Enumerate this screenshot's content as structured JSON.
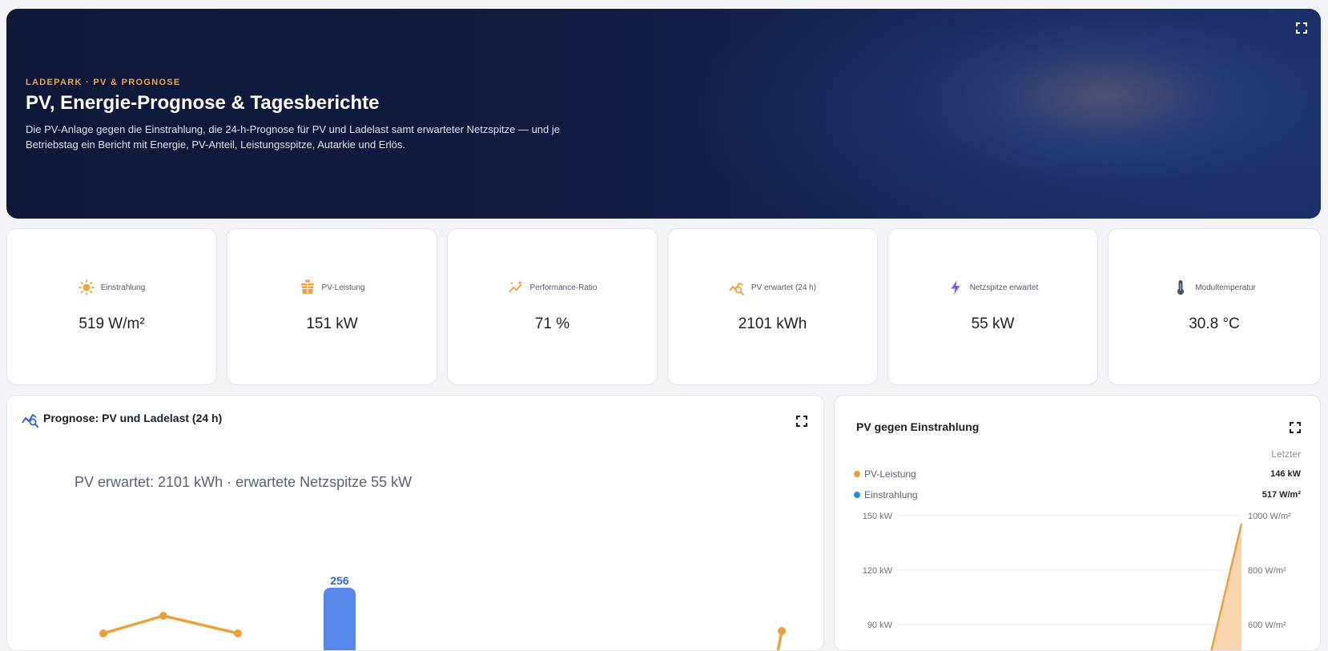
{
  "hero": {
    "eyebrow": "LADEPARK · PV & PROGNOSE",
    "title": "PV, Energie-Prognose & Tagesberichte",
    "description": "Die PV-Anlage gegen die Einstrahlung, die 24-h-Prognose für PV und Ladelast samt erwarteter Netzspitze — und je Betriebstag ein Bericht mit Energie, PV-Anteil, Leistungsspitze, Autarkie und Erlös."
  },
  "kpis": [
    {
      "label": "Einstrahlung",
      "value": "519 W/m²",
      "icon": "sun-icon",
      "color": "#f0a03c"
    },
    {
      "label": "PV-Leistung",
      "value": "151 kW",
      "icon": "solar-panel-icon",
      "color": "#f0a03c"
    },
    {
      "label": "Performance-Ratio",
      "value": "71 %",
      "icon": "sparkle-chart-icon",
      "color": "#f0a03c"
    },
    {
      "label": "PV erwartet (24 h)",
      "value": "2101 kWh",
      "icon": "forecast-icon",
      "color": "#f0a03c"
    },
    {
      "label": "Netzspitze erwartet",
      "value": "55 kW",
      "icon": "lightning-icon",
      "color": "#7b5cf0"
    },
    {
      "label": "Modultemperatur",
      "value": "30.8 °C",
      "icon": "thermometer-icon",
      "color": "#4a5068"
    }
  ],
  "forecast": {
    "title": "Prognose: PV und Ladelast (24 h)",
    "subtitle": "PV erwartet: 2101 kWh · erwartete Netzspitze 55 kW",
    "chart_data": {
      "type": "bar",
      "bar_label": "256",
      "bar_color": "#5588e8",
      "line_color": "#e8a23a"
    }
  },
  "pv_chart": {
    "title": "PV gegen Einstrahlung",
    "last_header": "Letzter",
    "legend": [
      {
        "name": "PV-Leistung",
        "value": "146 kW",
        "color": "#e8a23a"
      },
      {
        "name": "Einstrahlung",
        "value": "517 W/m²",
        "color": "#1f8fcf"
      }
    ],
    "chart_data": {
      "type": "area",
      "left_ticks": [
        "150 kW",
        "120 kW",
        "90 kW"
      ],
      "right_ticks": [
        "1000 W/m²",
        "800 W/m²",
        "600 W/m²"
      ],
      "line_color": "#e8a23a",
      "fill_color": "#f6d2a6"
    }
  }
}
